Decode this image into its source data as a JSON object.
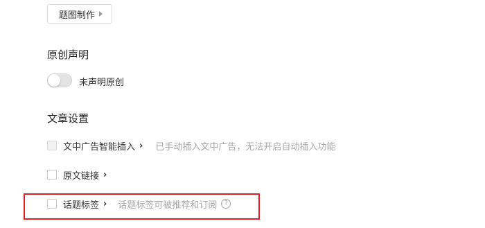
{
  "top_button": {
    "label": "题图制作"
  },
  "original": {
    "section_title": "原创声明",
    "toggle_on": false,
    "toggle_label": "未声明原创"
  },
  "article_settings": {
    "section_title": "文章设置",
    "items": [
      {
        "label": "文中广告智能插入",
        "chevron": "›",
        "checked": false,
        "disabled": true,
        "hint": "已手动插入文中广告，无法开启自动插入功能"
      },
      {
        "label": "原文链接",
        "chevron": "›",
        "checked": false,
        "disabled": false
      },
      {
        "label": "话题标签",
        "chevron": "›",
        "checked": false,
        "disabled": false,
        "hint": "话题标签可被推荐和订阅",
        "help_icon": "?",
        "highlighted": true
      }
    ]
  },
  "colors": {
    "highlight_border": "#e02020",
    "hint_text": "#a6a6a6"
  }
}
